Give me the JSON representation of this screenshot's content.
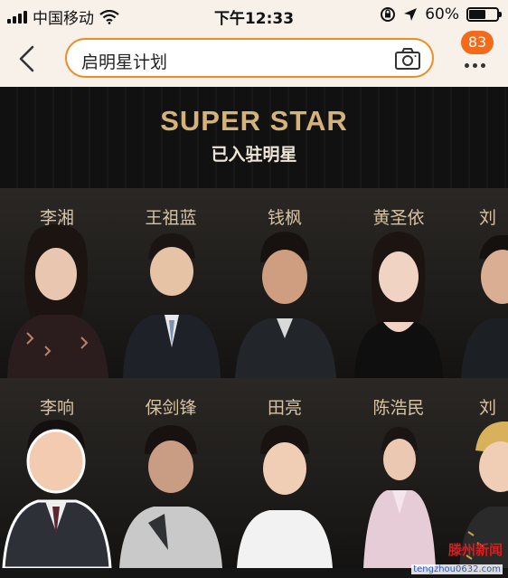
{
  "status_bar": {
    "carrier": "中国移动",
    "time": "下午12:33",
    "battery_pct_text": "60%",
    "battery_level": 0.6,
    "icons": [
      "signal-icon",
      "wifi-icon",
      "orientation-lock-icon",
      "location-arrow-icon",
      "battery-icon"
    ]
  },
  "nav": {
    "search_text": "启明星计划",
    "notification_count": "83",
    "icons": [
      "back-chevron-icon",
      "camera-icon",
      "more-dots-icon"
    ]
  },
  "banner": {
    "title": "SUPER STAR",
    "subtitle": "已入驻明星",
    "accent_color": "#d4b27a",
    "name_color": "#d8c3a0"
  },
  "celebrities": {
    "row1": [
      {
        "name": "李湘"
      },
      {
        "name": "王祖蓝"
      },
      {
        "name": "钱枫"
      },
      {
        "name": "黄圣依"
      },
      {
        "name": "刘"
      }
    ],
    "row2": [
      {
        "name": "李响"
      },
      {
        "name": "保剑锋"
      },
      {
        "name": "田亮"
      },
      {
        "name": "陈浩民"
      },
      {
        "name": "刘"
      }
    ]
  },
  "watermark": {
    "brand": "滕州新闻",
    "url": "tengzhou0632.com"
  },
  "colors": {
    "search_border": "#f08a24",
    "badge": "#f26b1d",
    "background_dark": "#151515"
  }
}
